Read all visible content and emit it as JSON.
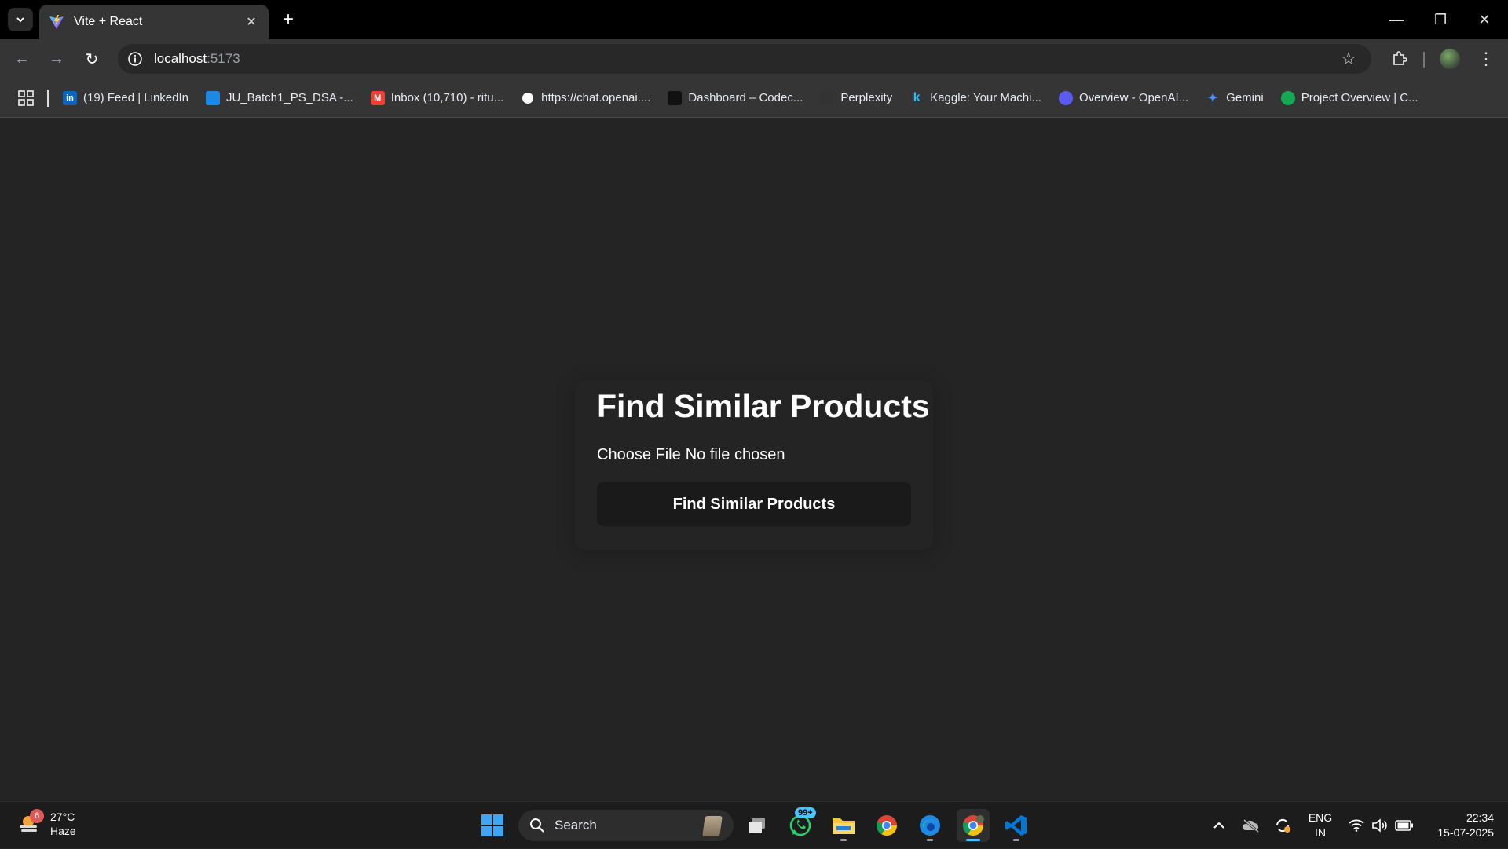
{
  "browser": {
    "tab": {
      "title": "Vite + React"
    },
    "address": {
      "host": "localhost",
      "port": ":5173"
    },
    "bookmarks": [
      {
        "label": "(19) Feed | LinkedIn",
        "icon": "linkedin-icon",
        "color": "#0a66c2",
        "glyph": "in"
      },
      {
        "label": "JU_Batch1_PS_DSA -...",
        "icon": "onedrive-icon",
        "color": "#1e88e5",
        "glyph": ""
      },
      {
        "label": "Inbox (10,710) - ritu...",
        "icon": "gmail-icon",
        "color": "#ea4335",
        "glyph": "M"
      },
      {
        "label": "https://chat.openai....",
        "icon": "openai-icon",
        "color": "#ffffff",
        "glyph": ""
      },
      {
        "label": "Dashboard – Codec...",
        "icon": "codec-icon",
        "color": "#111111",
        "glyph": ""
      },
      {
        "label": "Perplexity",
        "icon": "perplexity-icon",
        "color": "#333333",
        "glyph": ""
      },
      {
        "label": "Kaggle: Your Machi...",
        "icon": "kaggle-icon",
        "color": "#20beff",
        "glyph": "k"
      },
      {
        "label": "Overview - OpenAI...",
        "icon": "openai-overview-icon",
        "color": "#5b5bf0",
        "glyph": ""
      },
      {
        "label": "Gemini",
        "icon": "gemini-icon",
        "color": "#4f8df5",
        "glyph": "✦"
      },
      {
        "label": "Project Overview | C...",
        "icon": "mongodb-icon",
        "color": "#13aa52",
        "glyph": ""
      }
    ]
  },
  "page": {
    "heading": "Find Similar Products",
    "file_button": "Choose File",
    "file_status": "No file chosen",
    "submit_label": "Find Similar Products"
  },
  "taskbar": {
    "weather": {
      "temp": "27°C",
      "condition": "Haze",
      "badge": "6"
    },
    "search_label": "Search",
    "whatsapp_badge": "99+",
    "lang": {
      "line1": "ENG",
      "line2": "IN"
    },
    "clock": {
      "time": "22:34",
      "date": "15-07-2025"
    }
  },
  "colors": {
    "accent": "#4cc2ff",
    "page_bg": "#242424",
    "button_bg": "#1a1a1a"
  }
}
